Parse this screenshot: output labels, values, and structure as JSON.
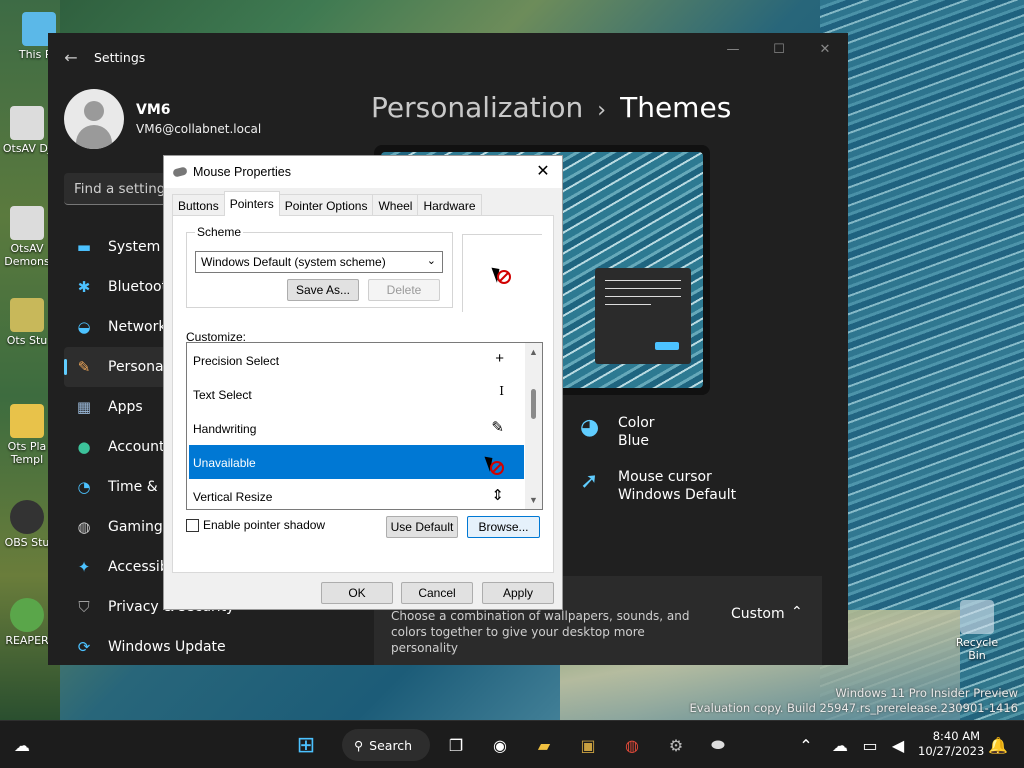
{
  "desktop": {
    "icons": [
      {
        "label": "This PC"
      },
      {
        "label": "OtsAV DJ"
      },
      {
        "label": "OtsAV Demons"
      },
      {
        "label": "Ots Stu"
      },
      {
        "label": "Ots Pla Templ"
      },
      {
        "label": "OBS Stu"
      },
      {
        "label": "REAPER"
      },
      {
        "label": "Recycle Bin"
      }
    ],
    "watermark": [
      "Windows 11 Pro Insider Preview",
      "Evaluation copy. Build 25947.rs_prerelease.230901-1416"
    ]
  },
  "settings": {
    "app_title": "Settings",
    "user_name": "VM6",
    "user_email": "VM6@collabnet.local",
    "search_placeholder": "Find a setting",
    "nav": [
      {
        "label": "System",
        "icon": "monitor-icon"
      },
      {
        "label": "Bluetooth",
        "icon": "bluetooth-icon"
      },
      {
        "label": "Network",
        "icon": "wifi-icon"
      },
      {
        "label": "Personali",
        "icon": "brush-icon"
      },
      {
        "label": "Apps",
        "icon": "apps-icon"
      },
      {
        "label": "Accounts",
        "icon": "person-icon"
      },
      {
        "label": "Time & la",
        "icon": "clock-icon"
      },
      {
        "label": "Gaming",
        "icon": "gamepad-icon"
      },
      {
        "label": "Accessibi",
        "icon": "accessibility-icon"
      },
      {
        "label": "Privacy & security",
        "icon": "shield-icon"
      },
      {
        "label": "Windows Update",
        "icon": "update-icon"
      }
    ],
    "breadcrumb_parent": "Personalization",
    "breadcrumb_sep": "›",
    "breadcrumb_current": "Themes",
    "color_label": "Color",
    "color_value": "Blue",
    "cursor_label": "Mouse cursor",
    "cursor_value": "Windows Default",
    "theme_desc": "Choose a combination of wallpapers, sounds, and colors together to give your desktop more personality",
    "theme_value": "Custom"
  },
  "dialog": {
    "title": "Mouse Properties",
    "tabs": [
      "Buttons",
      "Pointers",
      "Pointer Options",
      "Wheel",
      "Hardware"
    ],
    "scheme_label": "Scheme",
    "scheme_value": "Windows Default (system scheme)",
    "save_as": "Save As...",
    "delete": "Delete",
    "customize_label": "Customize:",
    "rows": [
      {
        "label": "Precision Select",
        "glyph": "+"
      },
      {
        "label": "Text Select",
        "glyph": "I"
      },
      {
        "label": "Handwriting",
        "glyph": "✎"
      },
      {
        "label": "Unavailable",
        "glyph": ""
      },
      {
        "label": "Vertical Resize",
        "glyph": "⇕"
      }
    ],
    "shadow_label": "Enable pointer shadow",
    "use_default": "Use Default",
    "browse": "Browse...",
    "ok": "OK",
    "cancel": "Cancel",
    "apply": "Apply"
  },
  "taskbar": {
    "search": "Search",
    "time": "8:40 AM",
    "date": "10/27/2023"
  }
}
